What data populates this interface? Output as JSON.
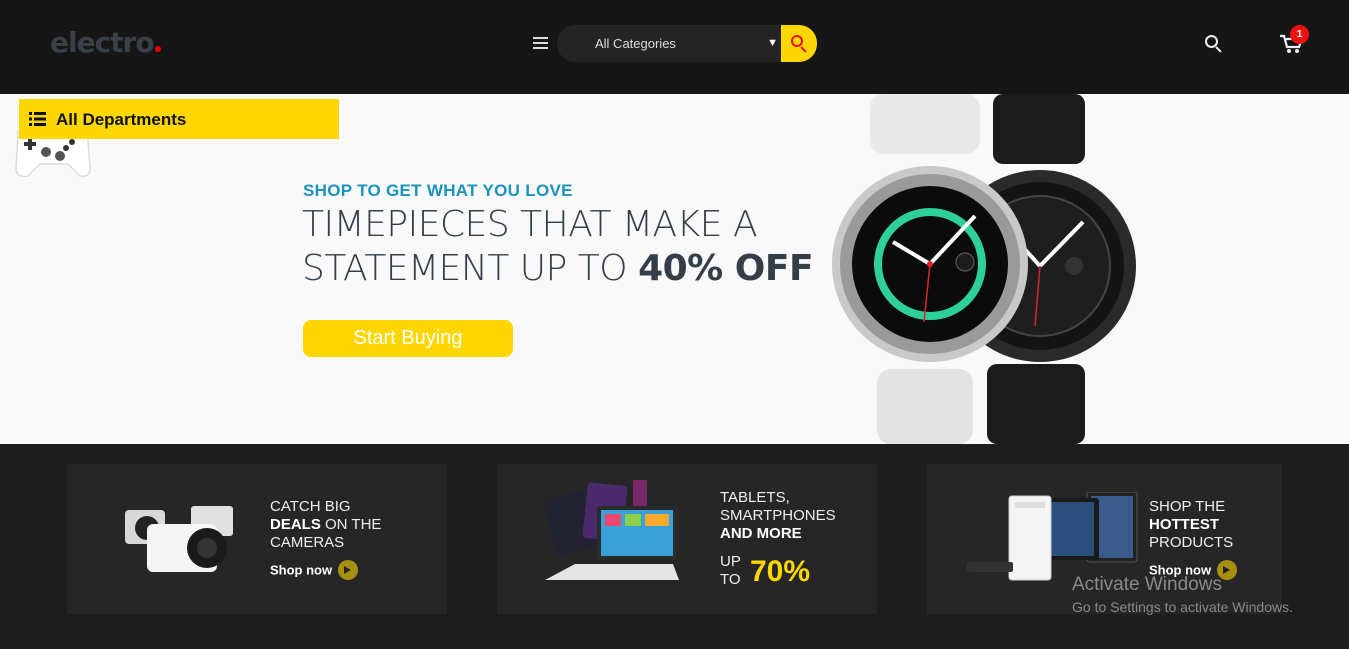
{
  "header": {
    "logo_text": "electro",
    "category_select": {
      "selected": "All Categories"
    },
    "cart_count": "1"
  },
  "departments": {
    "label": "All Departments"
  },
  "hero": {
    "eyebrow": "SHOP TO GET WHAT YOU LOVE",
    "title_line1": "TIMEPIECES THAT MAKE A",
    "title_line2": "STATEMENT UP TO ",
    "title_highlight": "40% OFF",
    "cta_label": "Start Buying"
  },
  "promos": [
    {
      "line1": "CATCH BIG",
      "line2_bold": "DEALS",
      "line2_rest": " ON THE",
      "line3": "CAMERAS",
      "shop_now": "Shop now"
    },
    {
      "line1": "TABLETS,",
      "line2": "SMARTPHONES",
      "line3_bold": "AND MORE",
      "up": "UP",
      "to": "TO",
      "discount": "70%"
    },
    {
      "line1": "SHOP THE",
      "line2_bold": "HOTTEST",
      "line3": "PRODUCTS",
      "shop_now": "Shop now"
    }
  ],
  "watermark": {
    "title": "Activate Windows",
    "subtitle": "Go to Settings to activate Windows."
  },
  "colors": {
    "accent": "#fed700",
    "eyebrow": "#1b93bd",
    "header_bg": "#161616",
    "badge": "#e11111"
  }
}
